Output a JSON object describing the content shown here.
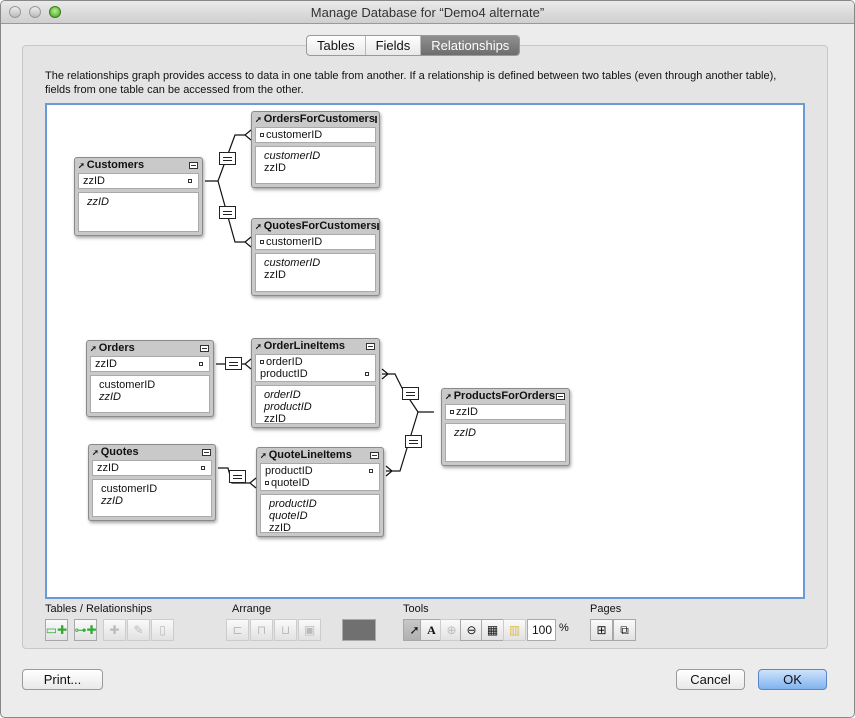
{
  "window": {
    "title": "Manage Database for “Demo4 alternate”"
  },
  "tabs": [
    {
      "label": "Tables",
      "active": false
    },
    {
      "label": "Fields",
      "active": false
    },
    {
      "label": "Relationships",
      "active": true
    }
  ],
  "description": "The relationships graph provides access to data in one table from another. If a relationship is defined between two tables (even through another table), fields from one table can be accessed from the other.",
  "tables": [
    {
      "name": "Customers",
      "keys": [
        {
          "name": "zzID",
          "side": "right"
        }
      ],
      "fields": [
        {
          "name": "zzID",
          "italic": true
        }
      ]
    },
    {
      "name": "OrdersForCustomers",
      "keys": [
        {
          "name": "customerID",
          "side": "left"
        }
      ],
      "fields": [
        {
          "name": "customerID",
          "italic": true
        },
        {
          "name": "zzID",
          "italic": false
        }
      ]
    },
    {
      "name": "QuotesForCustomers",
      "keys": [
        {
          "name": "customerID",
          "side": "left"
        }
      ],
      "fields": [
        {
          "name": "customerID",
          "italic": true
        },
        {
          "name": "zzID",
          "italic": false
        }
      ]
    },
    {
      "name": "Orders",
      "keys": [
        {
          "name": "zzID",
          "side": "right"
        }
      ],
      "fields": [
        {
          "name": "customerID",
          "italic": false
        },
        {
          "name": "zzID",
          "italic": true
        }
      ]
    },
    {
      "name": "OrderLineItems",
      "keys": [
        {
          "name": "orderID",
          "side": "left"
        },
        {
          "name": "productID",
          "side": "right"
        }
      ],
      "fields": [
        {
          "name": "orderID",
          "italic": true
        },
        {
          "name": "productID",
          "italic": true
        },
        {
          "name": "zzID",
          "italic": false
        }
      ]
    },
    {
      "name": "ProductsForOrders",
      "keys": [
        {
          "name": "zzID",
          "side": "left"
        }
      ],
      "fields": [
        {
          "name": "zzID",
          "italic": true
        }
      ]
    },
    {
      "name": "Quotes",
      "keys": [
        {
          "name": "zzID",
          "side": "right"
        }
      ],
      "fields": [
        {
          "name": "customerID",
          "italic": false
        },
        {
          "name": "zzID",
          "italic": true
        }
      ]
    },
    {
      "name": "QuoteLineItems",
      "keys": [
        {
          "name": "productID",
          "side": "right"
        },
        {
          "name": "quoteID",
          "side": "left"
        }
      ],
      "fields": [
        {
          "name": "productID",
          "italic": true
        },
        {
          "name": "quoteID",
          "italic": true
        },
        {
          "name": "zzID",
          "italic": false
        }
      ]
    }
  ],
  "relationships": [
    {
      "from": "Customers::zzID",
      "to": "OrdersForCustomers::customerID",
      "operator": "="
    },
    {
      "from": "Customers::zzID",
      "to": "QuotesForCustomers::customerID",
      "operator": "="
    },
    {
      "from": "Orders::zzID",
      "to": "OrderLineItems::orderID",
      "operator": "="
    },
    {
      "from": "OrderLineItems::productID",
      "to": "ProductsForOrders::zzID",
      "operator": "="
    },
    {
      "from": "QuoteLineItems::productID",
      "to": "ProductsForOrders::zzID",
      "operator": "="
    },
    {
      "from": "Quotes::zzID",
      "to": "QuoteLineItems::quoteID",
      "operator": "="
    }
  ],
  "toolbar": {
    "groups": {
      "tables": "Tables / Relationships",
      "arrange": "Arrange",
      "tools": "Tools",
      "pages": "Pages"
    },
    "tables_buttons": [
      "add-table",
      "add-relationship",
      "duplicate",
      "edit",
      "delete"
    ],
    "arrange_buttons": [
      "align",
      "distribute",
      "resize",
      "arrange-more"
    ],
    "color_swatch": "#707070",
    "tools_buttons": [
      "pointer",
      "text",
      "zoom-in",
      "zoom-out",
      "show-relationships",
      "select-related"
    ],
    "zoom_percent": "100",
    "percent_sign": "%",
    "pages_buttons": [
      "page-breaks",
      "page-setup"
    ]
  },
  "buttons": {
    "print": "Print...",
    "cancel": "Cancel",
    "ok": "OK"
  },
  "colors": {
    "canvas_border": "#6a9bd8",
    "default_button": "#7fb3ef"
  }
}
